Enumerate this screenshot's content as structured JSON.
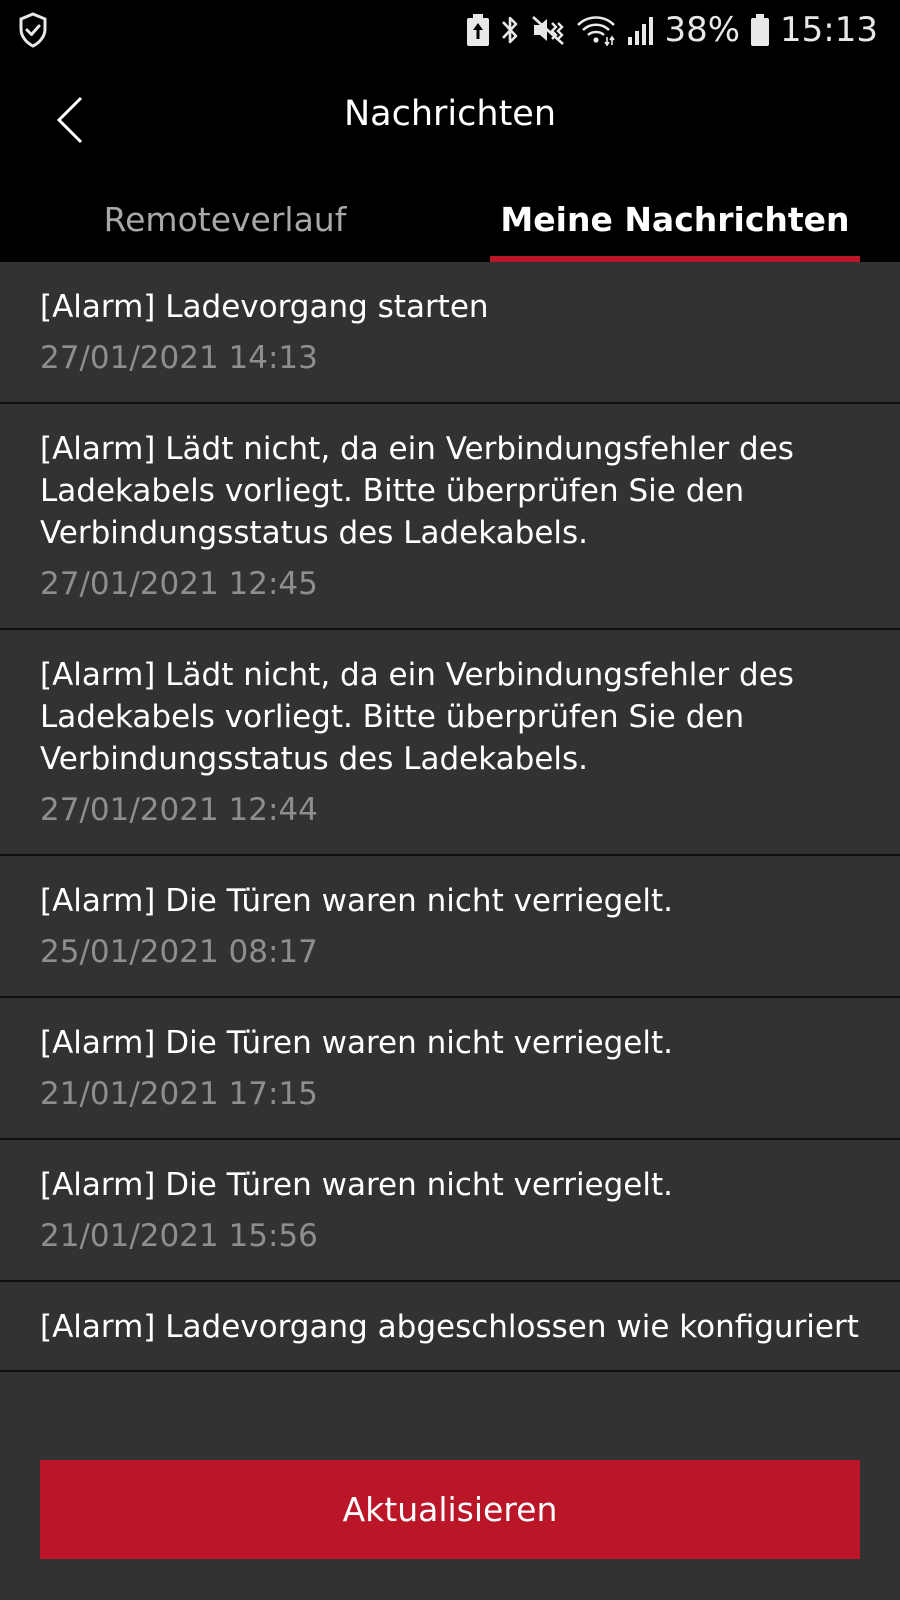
{
  "status_bar": {
    "battery_percent": "38%",
    "time": "15:13",
    "icons": [
      "shield-check-icon",
      "battery-saver-icon",
      "bluetooth-icon",
      "mute-vibrate-icon",
      "wifi-icon",
      "signal-icon",
      "battery-icon"
    ]
  },
  "header": {
    "title": "Nachrichten",
    "back_icon": "chevron-left-icon"
  },
  "tabs": [
    {
      "label": "Remoteverlauf",
      "active": false
    },
    {
      "label": "Meine Nachrichten",
      "active": true
    }
  ],
  "messages": [
    {
      "title": "[Alarm] Ladevorgang starten",
      "time": "27/01/2021 14:13"
    },
    {
      "title": "[Alarm] Lädt nicht, da ein Verbindungsfehler des Ladekabels vorliegt. Bitte überprüfen Sie den Verbindungsstatus des Ladekabels.",
      "time": "27/01/2021 12:45"
    },
    {
      "title": "[Alarm] Lädt nicht, da ein Verbindungsfehler des Ladekabels vorliegt. Bitte überprüfen Sie den Verbindungsstatus des Ladekabels.",
      "time": "27/01/2021 12:44"
    },
    {
      "title": "[Alarm] Die Türen waren nicht verriegelt.",
      "time": "25/01/2021 08:17"
    },
    {
      "title": "[Alarm] Die Türen waren nicht verriegelt.",
      "time": "21/01/2021 17:15"
    },
    {
      "title": "[Alarm] Die Türen waren nicht verriegelt.",
      "time": "21/01/2021 15:56"
    },
    {
      "title": "[Alarm] Ladevorgang abgeschlossen wie konfiguriert",
      "time": ""
    }
  ],
  "update_button": {
    "label": "Aktualisieren"
  },
  "colors": {
    "accent": "#bb1528",
    "list_background": "#323232",
    "header_background": "#000000",
    "timestamp": "#8e8e8e",
    "inactive_tab": "#a8a8a8"
  }
}
